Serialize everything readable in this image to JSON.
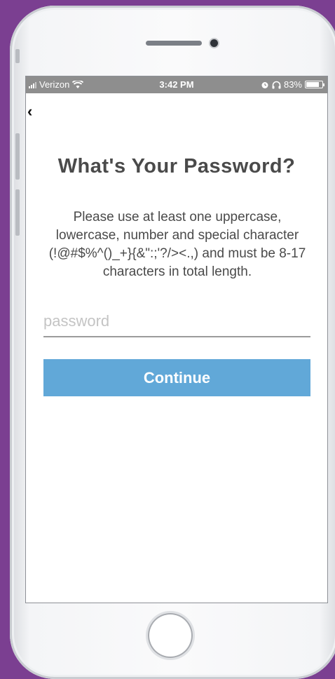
{
  "status_bar": {
    "carrier": "Verizon",
    "time": "3:42 PM",
    "battery": "83%",
    "battery_level": 0.83,
    "icons": [
      "signal-icon",
      "wifi-icon",
      "alarm-icon",
      "headphones-icon",
      "battery-icon"
    ]
  },
  "nav": {
    "back_glyph": "‹",
    "back_icon": "back-chevron-icon"
  },
  "page": {
    "title": "What's Your Password?",
    "description": "Please use at least one uppercase, lowercase, number and special character (!@#$%^()_+}{&\":;'?/><.,) and must be 8-17 characters in total length."
  },
  "form": {
    "password_placeholder": "password",
    "password_value": "",
    "continue_label": "Continue"
  },
  "colors": {
    "background": "#7b3f91",
    "status_bar": "#8e8e8e",
    "button": "#61a8d8",
    "text": "#4a4a4a"
  }
}
